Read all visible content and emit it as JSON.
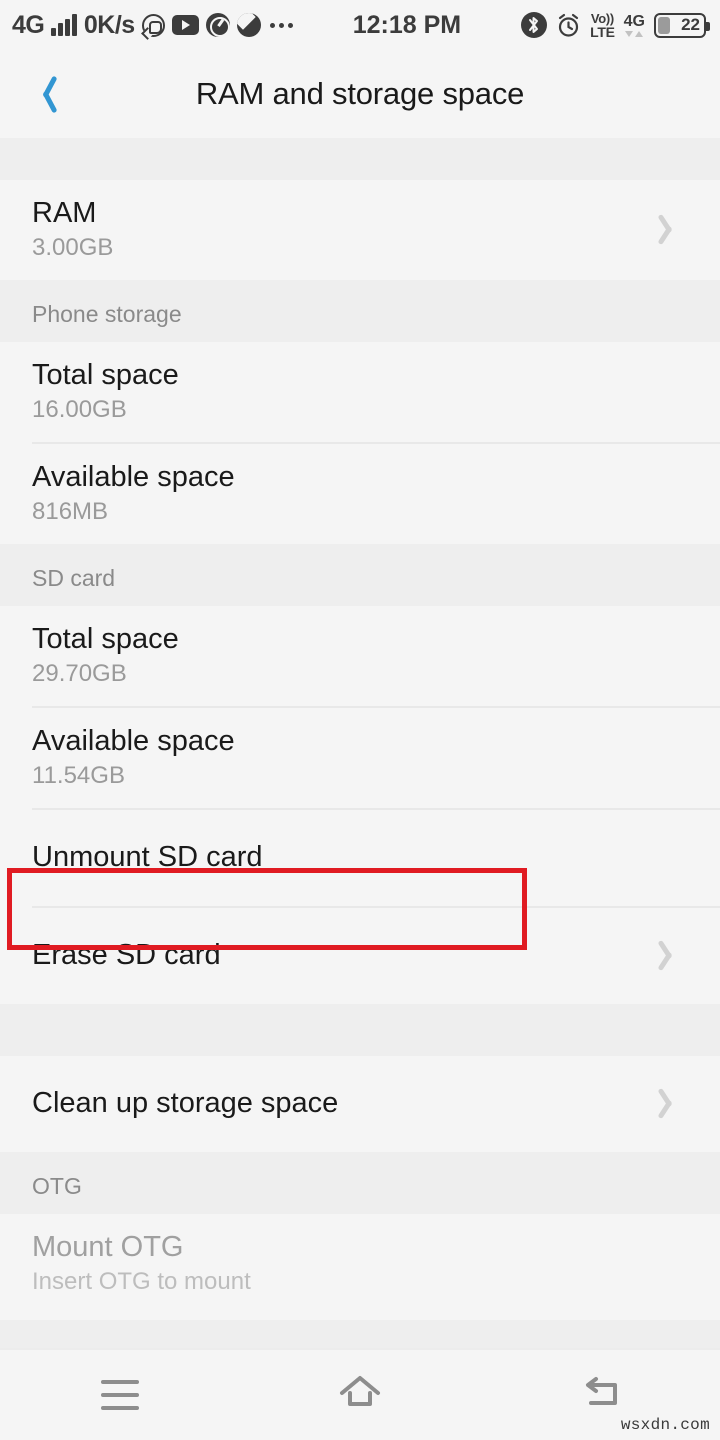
{
  "status_bar": {
    "network_label": "4G",
    "data_rate": "0K/s",
    "overflow": "...",
    "time": "12:18 PM",
    "volte_top": "Vo))",
    "volte_bottom": "LTE",
    "second_network_label": "4G",
    "battery_level": "22",
    "icons": [
      "signal-bars-icon",
      "whatsapp-icon",
      "youtube-icon",
      "gauge-icon",
      "half-circle-icon",
      "bluetooth-icon",
      "alarm-clock-icon",
      "volte-icon",
      "data-arrows-icon",
      "battery-icon"
    ]
  },
  "header": {
    "title": "RAM and storage space",
    "back_icon": "chevron-left-icon",
    "accent_color": "#3296d2"
  },
  "sections": [
    {
      "header": null,
      "rows": [
        {
          "title": "RAM",
          "subtitle": "3.00GB",
          "chevron": true,
          "disabled": false
        }
      ]
    },
    {
      "header": "Phone storage",
      "rows": [
        {
          "title": "Total space",
          "subtitle": "16.00GB",
          "chevron": false,
          "disabled": false
        },
        {
          "title": "Available space",
          "subtitle": "816MB",
          "chevron": false,
          "disabled": false
        }
      ]
    },
    {
      "header": "SD card",
      "rows": [
        {
          "title": "Total space",
          "subtitle": "29.70GB",
          "chevron": false,
          "disabled": false
        },
        {
          "title": "Available space",
          "subtitle": "11.54GB",
          "chevron": false,
          "disabled": false
        },
        {
          "title": "Unmount SD card",
          "subtitle": null,
          "chevron": false,
          "disabled": false
        },
        {
          "title": "Erase SD card",
          "subtitle": null,
          "chevron": true,
          "disabled": false,
          "highlighted": true
        }
      ]
    },
    {
      "header": null,
      "rows": [
        {
          "title": "Clean up storage space",
          "subtitle": null,
          "chevron": true,
          "disabled": false
        }
      ]
    },
    {
      "header": "OTG",
      "rows": [
        {
          "title": "Mount OTG",
          "subtitle": "Insert OTG to mount",
          "chevron": false,
          "disabled": true
        }
      ]
    }
  ],
  "highlight": {
    "color": "#e01b22",
    "target": "Erase SD card"
  },
  "nav_bar": {
    "menu_icon": "menu-icon",
    "home_icon": "home-icon",
    "back_icon": "back-arrow-icon"
  },
  "watermark": "wsxdn.com"
}
